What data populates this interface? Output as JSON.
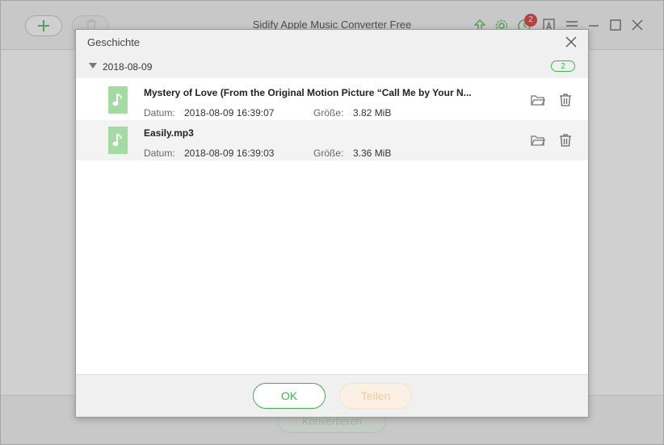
{
  "app": {
    "title": "Sidify Apple Music Converter Free",
    "notification_count": "2",
    "convert_label": "Konvertieren",
    "accent_color": "#3ab54a"
  },
  "dialog": {
    "title": "Geschichte",
    "group": {
      "date": "2018-08-09",
      "count": "2"
    },
    "date_label": "Datum:",
    "size_label": "Größe:",
    "items": [
      {
        "name": "Mystery of Love (From the Original Motion Picture “Call Me by Your N...",
        "date": "2018-08-09 16:39:07",
        "size": "3.82 MiB",
        "icon": "music-note-icon"
      },
      {
        "name": "Easily.mp3",
        "date": "2018-08-09 16:39:03",
        "size": "3.36 MiB",
        "icon": "music-note-icon"
      }
    ],
    "ok_label": "OK",
    "share_label": "Teilen"
  }
}
